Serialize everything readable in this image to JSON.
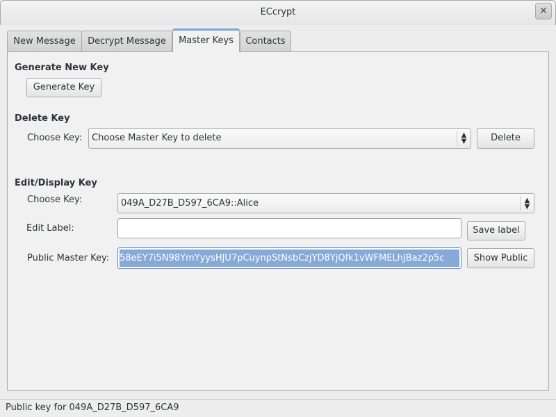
{
  "window": {
    "title": "ECcrypt",
    "close": "✕"
  },
  "tabs": [
    "New Message",
    "Decrypt Message",
    "Master Keys",
    "Contacts"
  ],
  "generate": {
    "heading": "Generate New Key",
    "button": "Generate Key"
  },
  "delete": {
    "heading": "Delete Key",
    "choose_label": "Choose Key:",
    "choose_value": "Choose Master Key to delete",
    "button": "Delete"
  },
  "edit": {
    "heading": "Edit/Display Key",
    "choose_label": "Choose Key:",
    "choose_value": "049A_D27B_D597_6CA9::Alice",
    "label_label": "Edit Label:",
    "label_value": "",
    "save_button": "Save label",
    "public_label": "Public Master Key:",
    "public_value": "58eEY7i5N98YmYyysHJU7pCuynpStNsbCzjYD8YjQfk1vWFMELhJBaz2p5c",
    "show_button": "Show Public"
  },
  "status": "Public key for 049A_D27B_D597_6CA9"
}
